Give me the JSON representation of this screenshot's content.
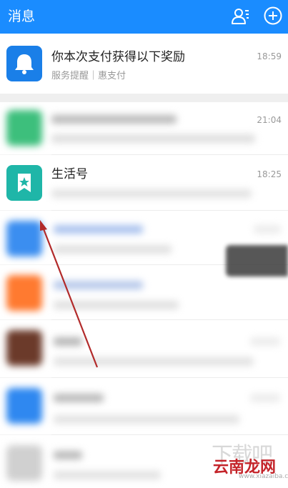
{
  "header": {
    "title": "消息",
    "contacts_icon": "contacts-icon",
    "add_icon": "plus-circle-icon",
    "bg_color": "#1a8cff"
  },
  "messages": [
    {
      "name": "你本次支付获得以下奖励",
      "subtitle": "服务提醒｜惠支付",
      "time": "18:59",
      "icon": "bell-icon",
      "color": "#1a7fe8"
    },
    {
      "name": "",
      "subtitle": "",
      "time": "21:04",
      "icon": "blurred-avatar",
      "color": "#3dbf7c"
    },
    {
      "name": "生活号",
      "subtitle": "",
      "time": "18:25",
      "icon": "star-bookmark-icon",
      "color": "#1fb6a8"
    },
    {
      "name": "",
      "subtitle": "",
      "time": "",
      "icon": "blurred-avatar",
      "color": "#3b8ef0"
    },
    {
      "name": "",
      "subtitle": "",
      "time": "",
      "icon": "blurred-avatar",
      "color": "#ff7a30"
    },
    {
      "name": "",
      "subtitle": "",
      "time": "",
      "icon": "blurred-avatar",
      "color": "#6b3a2a"
    },
    {
      "name": "",
      "subtitle": "",
      "time": "",
      "icon": "blurred-avatar",
      "color": "#2f88f0"
    },
    {
      "name": "",
      "subtitle": "",
      "time": "",
      "icon": "blurred-avatar",
      "color": "#d0d0d0"
    }
  ],
  "watermark": {
    "logo_text": "云南龙网",
    "url": "www.xiazaiba.com"
  }
}
